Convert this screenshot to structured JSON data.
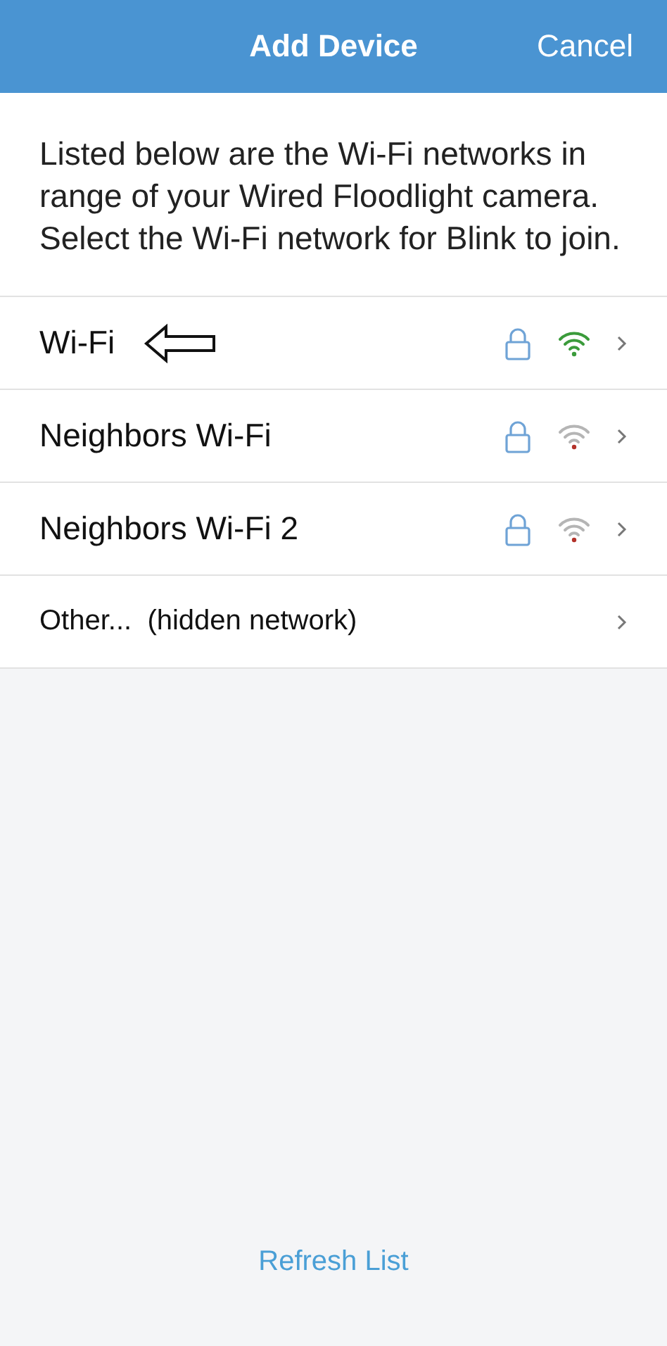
{
  "header": {
    "title": "Add Device",
    "cancel": "Cancel"
  },
  "intro": "Listed below are the Wi-Fi networks in range of your Wired Floodlight camera. Select the Wi-Fi network for Blink to join.",
  "networks": [
    {
      "kind": "network",
      "name": "Wi-Fi",
      "locked": true,
      "weak_signal": false,
      "pointed_at": true
    },
    {
      "kind": "network",
      "name": "Neighbors Wi-Fi",
      "locked": true,
      "weak_signal": true,
      "pointed_at": false
    },
    {
      "kind": "network",
      "name": "Neighbors Wi-Fi 2",
      "locked": true,
      "weak_signal": true,
      "pointed_at": false
    },
    {
      "kind": "other",
      "name": "Other...  (hidden network)"
    }
  ],
  "refresh": "Refresh List"
}
